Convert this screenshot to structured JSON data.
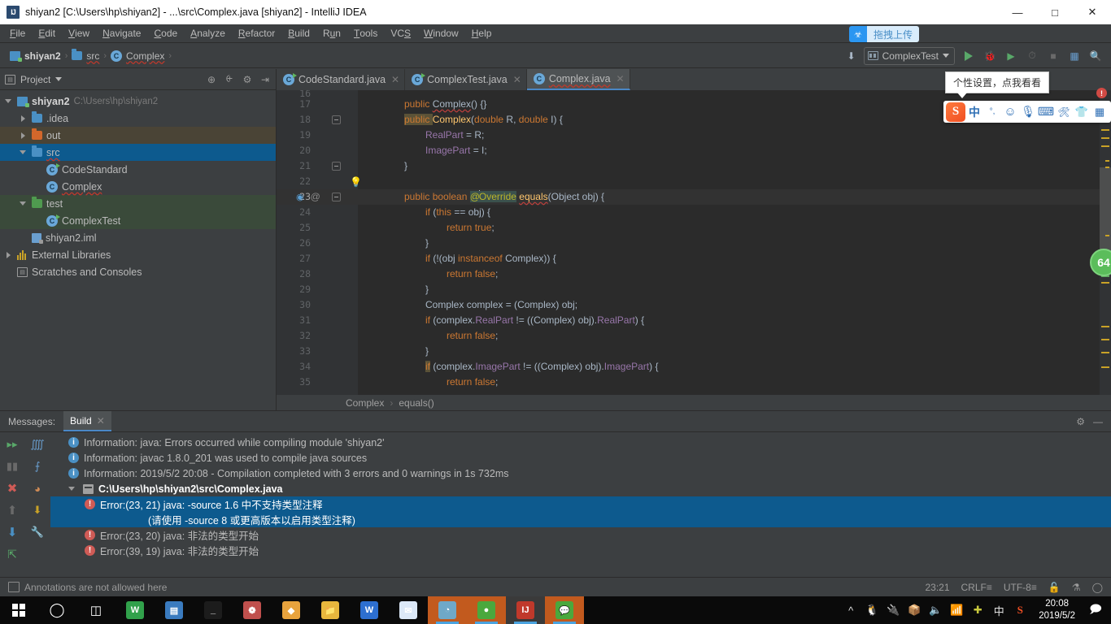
{
  "window": {
    "title": "shiyan2 [C:\\Users\\hp\\shiyan2] - ...\\src\\Complex.java [shiyan2] - IntelliJ IDEA",
    "app_icon": "intellij-idea-icon",
    "minimize": "—",
    "maximize": "□",
    "close": "✕"
  },
  "menubar": {
    "items": [
      {
        "label": "File",
        "mnemonic": "F"
      },
      {
        "label": "Edit",
        "mnemonic": "E"
      },
      {
        "label": "View",
        "mnemonic": "V"
      },
      {
        "label": "Navigate",
        "mnemonic": "N"
      },
      {
        "label": "Code",
        "mnemonic": "C"
      },
      {
        "label": "Analyze",
        "mnemonic": "A"
      },
      {
        "label": "Refactor",
        "mnemonic": "R"
      },
      {
        "label": "Build",
        "mnemonic": "B"
      },
      {
        "label": "Run",
        "mnemonic": "u"
      },
      {
        "label": "Tools",
        "mnemonic": "T"
      },
      {
        "label": "VCS",
        "mnemonic": "S"
      },
      {
        "label": "Window",
        "mnemonic": "W"
      },
      {
        "label": "Help",
        "mnemonic": "H"
      }
    ],
    "upload_button": {
      "icon": "baidu-netdisk-icon",
      "label": "拖拽上传"
    }
  },
  "navbar": {
    "breadcrumbs": [
      {
        "label": "shiyan2",
        "icon": "module-icon"
      },
      {
        "label": "src",
        "icon": "folder-icon"
      },
      {
        "label": "Complex",
        "icon": "java-class-icon"
      }
    ],
    "separator": "›",
    "run_config": {
      "label": "ComplexTest",
      "icon": "run-config-icon"
    },
    "buttons": [
      {
        "name": "compile-icon",
        "glyph": "⬇"
      },
      {
        "name": "run-button",
        "glyph": "▶"
      },
      {
        "name": "debug-button",
        "glyph": "🐞"
      },
      {
        "name": "run-coverage-button",
        "glyph": "▶"
      },
      {
        "name": "profile-button",
        "glyph": "◴"
      },
      {
        "name": "stop-button",
        "glyph": "■"
      },
      {
        "name": "project-structure-button",
        "glyph": "☰"
      },
      {
        "name": "search-everywhere-icon",
        "glyph": "🔍"
      }
    ]
  },
  "project_panel": {
    "title": "Project",
    "title_icon": "project-view-icon",
    "header_icons": [
      {
        "name": "locate-icon",
        "glyph": "⊕"
      },
      {
        "name": "expand-collapse-icon",
        "glyph": "⨍"
      },
      {
        "name": "settings-gear-icon",
        "glyph": "⚙"
      },
      {
        "name": "hide-panel-icon",
        "glyph": "⇥"
      }
    ],
    "tree": [
      {
        "label": "shiyan2",
        "sub": "C:\\Users\\hp\\shiyan2",
        "icon": "module-icon",
        "state": "open",
        "depth": 0,
        "bold": true
      },
      {
        "label": ".idea",
        "icon": "folder-icon",
        "state": "closed",
        "depth": 1
      },
      {
        "label": "out",
        "icon": "folder-orange-icon",
        "state": "closed",
        "depth": 1,
        "highlight": "out"
      },
      {
        "label": "src",
        "icon": "folder-blue-icon",
        "state": "open",
        "depth": 1,
        "selected": true,
        "wavy": true
      },
      {
        "label": "CodeStandard",
        "icon": "java-class-runnable-icon",
        "depth": 2
      },
      {
        "label": "Complex",
        "icon": "java-class-icon",
        "depth": 2,
        "wavy": true
      },
      {
        "label": "test",
        "icon": "folder-green-icon",
        "state": "open",
        "depth": 1,
        "highlight": "test"
      },
      {
        "label": "ComplexTest",
        "icon": "java-class-runnable-icon",
        "depth": 2,
        "highlight": "test"
      },
      {
        "label": "shiyan2.iml",
        "icon": "iml-file-icon",
        "depth": 1
      },
      {
        "label": "External Libraries",
        "icon": "libraries-icon",
        "state": "closed",
        "depth": 0
      },
      {
        "label": "Scratches and Consoles",
        "icon": "scratches-icon",
        "depth": 0
      }
    ]
  },
  "editor": {
    "tabs": [
      {
        "label": "CodeStandard.java",
        "icon": "java-class-runnable-icon",
        "active": false,
        "close": "✕"
      },
      {
        "label": "ComplexTest.java",
        "icon": "java-class-runnable-icon",
        "active": false,
        "close": "✕"
      },
      {
        "label": "Complex.java",
        "icon": "java-class-icon",
        "active": true,
        "close": "✕",
        "wavy": true
      }
    ],
    "first_line": 16,
    "lines": [
      {
        "n": 17,
        "indent": 2,
        "tokens": [
          {
            "t": "public ",
            "c": "kw"
          },
          {
            "t": "Complex",
            "c": "cls wavy-err"
          },
          {
            "t": "() {}",
            "c": "pln"
          }
        ]
      },
      {
        "n": 18,
        "fold": true,
        "tokens": [
          {
            "t": "public ",
            "c": "kw kw-hl"
          },
          {
            "t": "Complex",
            "c": "mth"
          },
          {
            "t": "(",
            "c": "pln"
          },
          {
            "t": "double ",
            "c": "kw"
          },
          {
            "t": "R",
            "c": "pln"
          },
          {
            "t": ", ",
            "c": "pln"
          },
          {
            "t": "double ",
            "c": "kw"
          },
          {
            "t": "I",
            "c": "pln"
          },
          {
            "t": ") {",
            "c": "pln"
          }
        ],
        "indent": 2
      },
      {
        "n": 19,
        "indent": 3,
        "tokens": [
          {
            "t": "RealPart",
            "c": "fld"
          },
          {
            "t": " = R;",
            "c": "pln"
          }
        ]
      },
      {
        "n": 20,
        "indent": 3,
        "tokens": [
          {
            "t": "ImagePart",
            "c": "fld"
          },
          {
            "t": " = I;",
            "c": "pln"
          }
        ]
      },
      {
        "n": 21,
        "indent": 2,
        "fold": true,
        "tokens": [
          {
            "t": "}",
            "c": "pln"
          }
        ]
      },
      {
        "n": 22,
        "indent": 2,
        "tokens": [],
        "bulb": true
      },
      {
        "n": 23,
        "indent": 2,
        "current": true,
        "fold": true,
        "gutter": "override-at",
        "tokens": [
          {
            "t": "public ",
            "c": "kw"
          },
          {
            "t": "boolean ",
            "c": "kw"
          },
          {
            "t": "@",
            "c": "ann ident-hl"
          },
          {
            "t": "caret",
            "c": "caret"
          },
          {
            "t": "Override",
            "c": "ann ident-hl"
          },
          {
            "t": " ",
            "c": "pln"
          },
          {
            "t": "equals",
            "c": "mth wavy-err"
          },
          {
            "t": "(",
            "c": "pln"
          },
          {
            "t": "Object",
            "c": "cls"
          },
          {
            "t": " obj) {",
            "c": "pln"
          }
        ]
      },
      {
        "n": 24,
        "indent": 3,
        "tokens": [
          {
            "t": "if",
            "c": "kw"
          },
          {
            "t": " (",
            "c": "pln"
          },
          {
            "t": "this",
            "c": "kw"
          },
          {
            "t": " == obj) {",
            "c": "pln"
          }
        ]
      },
      {
        "n": 25,
        "indent": 4,
        "tokens": [
          {
            "t": "return ",
            "c": "kw"
          },
          {
            "t": "true",
            "c": "kw"
          },
          {
            "t": ";",
            "c": "pln"
          }
        ]
      },
      {
        "n": 26,
        "indent": 3,
        "tokens": [
          {
            "t": "}",
            "c": "pln"
          }
        ]
      },
      {
        "n": 27,
        "indent": 3,
        "tokens": [
          {
            "t": "if",
            "c": "kw"
          },
          {
            "t": " (!(obj ",
            "c": "pln"
          },
          {
            "t": "instanceof ",
            "c": "kw"
          },
          {
            "t": "Complex",
            "c": "cls"
          },
          {
            "t": ")) {",
            "c": "pln"
          }
        ]
      },
      {
        "n": 28,
        "indent": 4,
        "tokens": [
          {
            "t": "return ",
            "c": "kw"
          },
          {
            "t": "false",
            "c": "kw"
          },
          {
            "t": ";",
            "c": "pln"
          }
        ]
      },
      {
        "n": 29,
        "indent": 3,
        "tokens": [
          {
            "t": "}",
            "c": "pln"
          }
        ]
      },
      {
        "n": 30,
        "indent": 3,
        "tokens": [
          {
            "t": "Complex",
            "c": "cls"
          },
          {
            "t": " complex = (",
            "c": "pln"
          },
          {
            "t": "Complex",
            "c": "cls"
          },
          {
            "t": ") obj;",
            "c": "pln"
          }
        ]
      },
      {
        "n": 31,
        "indent": 3,
        "tokens": [
          {
            "t": "if",
            "c": "kw"
          },
          {
            "t": " (complex.",
            "c": "pln"
          },
          {
            "t": "RealPart",
            "c": "fld"
          },
          {
            "t": " != ((",
            "c": "pln"
          },
          {
            "t": "Complex",
            "c": "cls"
          },
          {
            "t": ") obj).",
            "c": "pln"
          },
          {
            "t": "RealPart",
            "c": "fld"
          },
          {
            "t": ") {",
            "c": "pln"
          }
        ]
      },
      {
        "n": 32,
        "indent": 4,
        "tokens": [
          {
            "t": "return ",
            "c": "kw"
          },
          {
            "t": "false",
            "c": "kw"
          },
          {
            "t": ";",
            "c": "pln"
          }
        ]
      },
      {
        "n": 33,
        "indent": 3,
        "tokens": [
          {
            "t": "}",
            "c": "pln"
          }
        ]
      },
      {
        "n": 34,
        "indent": 3,
        "tokens": [
          {
            "t": "if",
            "c": "kw kw-hl"
          },
          {
            "t": " (complex.",
            "c": "pln"
          },
          {
            "t": "ImagePart",
            "c": "fld"
          },
          {
            "t": " != ((",
            "c": "pln"
          },
          {
            "t": "Complex",
            "c": "cls"
          },
          {
            "t": ") obj).",
            "c": "pln"
          },
          {
            "t": "ImagePart",
            "c": "fld"
          },
          {
            "t": ") {",
            "c": "pln"
          }
        ]
      },
      {
        "n": 35,
        "indent": 4,
        "tokens": [
          {
            "t": "return ",
            "c": "kw"
          },
          {
            "t": "false",
            "c": "kw"
          },
          {
            "t": ";",
            "c": "pln"
          }
        ]
      }
    ],
    "breadcrumb": [
      "Complex",
      "equals()"
    ],
    "breadcrumb_sep": "›",
    "inspection_badge": "64"
  },
  "messages": {
    "panel_label": "Messages:",
    "tab": {
      "label": "Build",
      "close": "✕"
    },
    "toolbar_left": [
      {
        "name": "rerun-icon",
        "glyph": "▶▶"
      },
      {
        "name": "stop-icon",
        "glyph": "■"
      },
      {
        "name": "close-messages-icon",
        "glyph": "✕"
      },
      {
        "name": "previous-message-icon",
        "glyph": "↑"
      },
      {
        "name": "next-message-icon",
        "glyph": "↓"
      },
      {
        "name": "export-icon",
        "glyph": "⤴"
      }
    ],
    "toolbar_right": [
      {
        "name": "expand-all-icon",
        "glyph": "⨌"
      },
      {
        "name": "collapse-all-icon",
        "glyph": "⨍"
      },
      {
        "name": "hide-warnings-icon",
        "glyph": "◑"
      },
      {
        "name": "download-icon",
        "glyph": "⬇"
      },
      {
        "name": "build-settings-icon",
        "glyph": "🔧"
      }
    ],
    "header_right_icons": [
      {
        "name": "settings-gear-icon",
        "glyph": "⚙"
      },
      {
        "name": "hide-tool-window-icon",
        "glyph": "—"
      }
    ],
    "rows": [
      {
        "kind": "info",
        "indent": 1,
        "text": "Information: java: Errors occurred while compiling module 'shiyan2'"
      },
      {
        "kind": "info",
        "indent": 1,
        "text": "Information: javac 1.8.0_201 was used to compile java sources"
      },
      {
        "kind": "info",
        "indent": 1,
        "text": "Information: 2019/5/2 20:08 - Compilation completed with 3 errors and 0 warnings in 1s 732ms"
      },
      {
        "kind": "file",
        "indent": 1,
        "expander": "open",
        "text": "C:\\Users\\hp\\shiyan2\\src\\Complex.java"
      },
      {
        "kind": "error",
        "indent": 2,
        "selected": true,
        "text": "Error:(23, 21)  java: -source 1.6 中不支持类型注释"
      },
      {
        "kind": "plain",
        "indent": 3,
        "selected": true,
        "text": "(请使用 -source 8 或更高版本以启用类型注释)"
      },
      {
        "kind": "error",
        "indent": 2,
        "text": "Error:(23, 20)  java: 非法的类型开始"
      },
      {
        "kind": "error",
        "indent": 2,
        "text": "Error:(39, 19)  java: 非法的类型开始"
      }
    ]
  },
  "statusbar": {
    "message": "Annotations are not allowed here",
    "message_icon": "event-log-icon",
    "caret_position": "23:21",
    "line_separator": "CRLF≡",
    "encoding": "UTF-8≡",
    "read_only_icon": "lock-open-icon",
    "vcs_icon": "branch-icon",
    "inspections_icon": "inspections-icon"
  },
  "ime": {
    "tooltip": "个性设置，点我看看",
    "logo": "S",
    "buttons": [
      {
        "name": "ime-mode-chinese-icon",
        "glyph": "中"
      },
      {
        "name": "ime-punctuation-icon",
        "glyph": "°,"
      },
      {
        "name": "ime-emoji-icon",
        "glyph": "☺"
      },
      {
        "name": "ime-voice-input-icon",
        "glyph": "🎤"
      },
      {
        "name": "ime-soft-keyboard-icon",
        "glyph": "⌨"
      },
      {
        "name": "ime-toolbox-icon",
        "glyph": "🧰"
      },
      {
        "name": "ime-skin-icon",
        "glyph": "👕"
      },
      {
        "name": "ime-menu-icon",
        "glyph": "⬛"
      }
    ]
  },
  "taskbar": {
    "start": {
      "name": "start-button",
      "icon": "windows-logo-icon"
    },
    "search": {
      "name": "search-button",
      "glyph": "○"
    },
    "task_view": {
      "name": "task-view-button",
      "glyph": "⧉"
    },
    "items": [
      {
        "name": "taskbar-app-wps",
        "label": "W",
        "color": "#31a14b"
      },
      {
        "name": "taskbar-app-editor",
        "label": "▤",
        "color": "#3a7bbf"
      },
      {
        "name": "taskbar-app-terminal",
        "label": "_",
        "color": "#1c1c1c"
      },
      {
        "name": "taskbar-app-pinwheel",
        "label": "❁",
        "color": "#c0504d"
      },
      {
        "name": "taskbar-app-colorful",
        "label": "◆",
        "color": "#e8a33d"
      },
      {
        "name": "taskbar-app-explorer",
        "label": "📁",
        "color": "#e8b73d"
      },
      {
        "name": "taskbar-app-wechat-work",
        "label": "W",
        "color": "#2d6fd0"
      },
      {
        "name": "taskbar-app-foxmail",
        "label": "✉",
        "color": "#dce8f7"
      },
      {
        "name": "taskbar-app-photos",
        "label": "◔",
        "color": "#6fa8c8",
        "active": "orange"
      },
      {
        "name": "taskbar-app-browser",
        "label": "●",
        "color": "#4aa83d",
        "active": "orange"
      },
      {
        "name": "taskbar-app-intellij",
        "label": "IJ",
        "color": "#c0392b",
        "active": "dark"
      },
      {
        "name": "taskbar-app-wechat",
        "label": "💬",
        "color": "#4aa83d",
        "active": "orange"
      }
    ],
    "tray": {
      "expand": "⌃",
      "icons": [
        {
          "name": "tray-qq-icon",
          "glyph": "🐧"
        },
        {
          "name": "tray-battery-icon",
          "glyph": "🔌"
        },
        {
          "name": "tray-package-icon",
          "glyph": "📦"
        },
        {
          "name": "tray-volume-icon",
          "glyph": "🔊"
        },
        {
          "name": "tray-network-icon",
          "glyph": "📶"
        },
        {
          "name": "tray-security-icon",
          "glyph": "⊕"
        },
        {
          "name": "tray-ime-mode-icon",
          "glyph": "中"
        },
        {
          "name": "tray-sogou-icon",
          "glyph": "S"
        }
      ],
      "time": "20:08",
      "date": "2019/5/2",
      "action_center": "💬"
    }
  }
}
